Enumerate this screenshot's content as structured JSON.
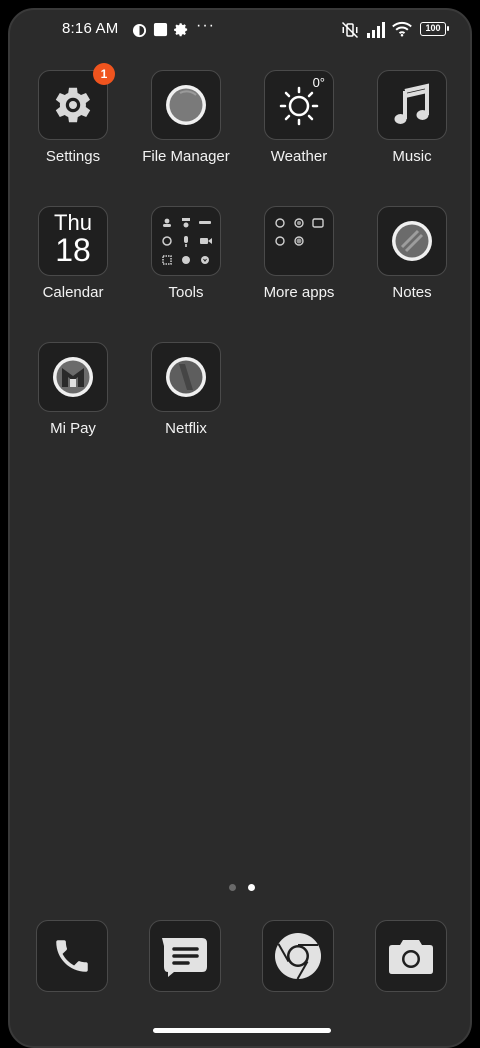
{
  "status_bar": {
    "time": "8:16 AM",
    "battery": "100"
  },
  "apps": [
    {
      "label": "Settings",
      "icon": "settings-gear-icon",
      "badge": "1"
    },
    {
      "label": "File Manager",
      "icon": "file-manager-icon"
    },
    {
      "label": "Weather",
      "icon": "sun-icon",
      "temp": "0°"
    },
    {
      "label": "Music",
      "icon": "music-note-icon"
    },
    {
      "label": "Calendar",
      "icon": "calendar-icon",
      "day": "Thu",
      "date": "18"
    },
    {
      "label": "Tools",
      "icon": "tools-folder-icon"
    },
    {
      "label": "More apps",
      "icon": "more-apps-folder-icon"
    },
    {
      "label": "Notes",
      "icon": "notes-icon"
    },
    {
      "label": "Mi Pay",
      "icon": "mi-pay-icon"
    },
    {
      "label": "Netflix",
      "icon": "netflix-icon"
    }
  ],
  "page_indicator": {
    "count": 2,
    "active": 2
  },
  "dock": [
    {
      "name": "phone",
      "icon": "phone-icon"
    },
    {
      "name": "messages",
      "icon": "message-icon"
    },
    {
      "name": "chrome",
      "icon": "chrome-icon"
    },
    {
      "name": "camera",
      "icon": "camera-icon"
    }
  ],
  "colors": {
    "badge": "#f0541e",
    "background": "#2b2b2b",
    "tile": "#1f1f1f"
  }
}
